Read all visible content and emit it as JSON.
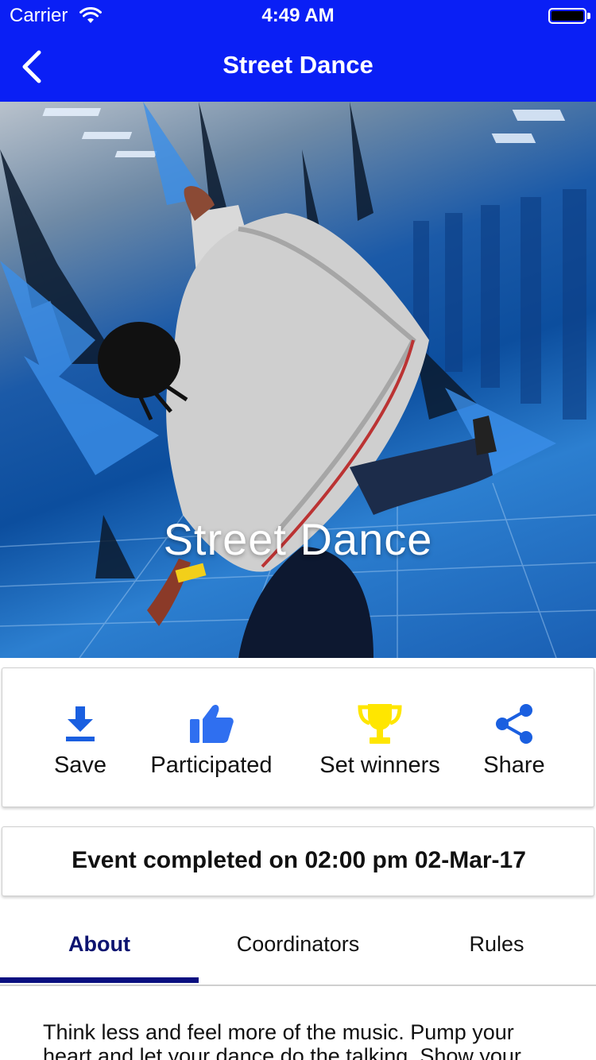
{
  "status_bar": {
    "carrier": "Carrier",
    "time": "4:49 AM",
    "wifi_icon": "wifi-icon",
    "battery_icon": "battery-icon",
    "battery_level": 1.0
  },
  "nav": {
    "title": "Street Dance",
    "back_icon": "chevron-left-icon",
    "background_color": "#0a1ff5"
  },
  "hero": {
    "title": "Street Dance"
  },
  "actions": [
    {
      "label": "Save",
      "icon": "download-icon",
      "color": "#1a5fe0"
    },
    {
      "label": "Participated",
      "icon": "thumbs-up-icon",
      "color": "#2f6ff0"
    },
    {
      "label": "Set winners",
      "icon": "trophy-icon",
      "color": "#ffe600"
    },
    {
      "label": "Share",
      "icon": "share-icon",
      "color": "#1a5fe0"
    }
  ],
  "event": {
    "status_text": "Event completed on 02:00 pm 02-Mar-17"
  },
  "tabs": [
    {
      "label": "About",
      "active": true
    },
    {
      "label": "Coordinators",
      "active": false
    },
    {
      "label": "Rules",
      "active": false
    }
  ],
  "about": {
    "text": "Think less and feel more of the music. Pump your heart and let your dance do the talking. Show your"
  }
}
